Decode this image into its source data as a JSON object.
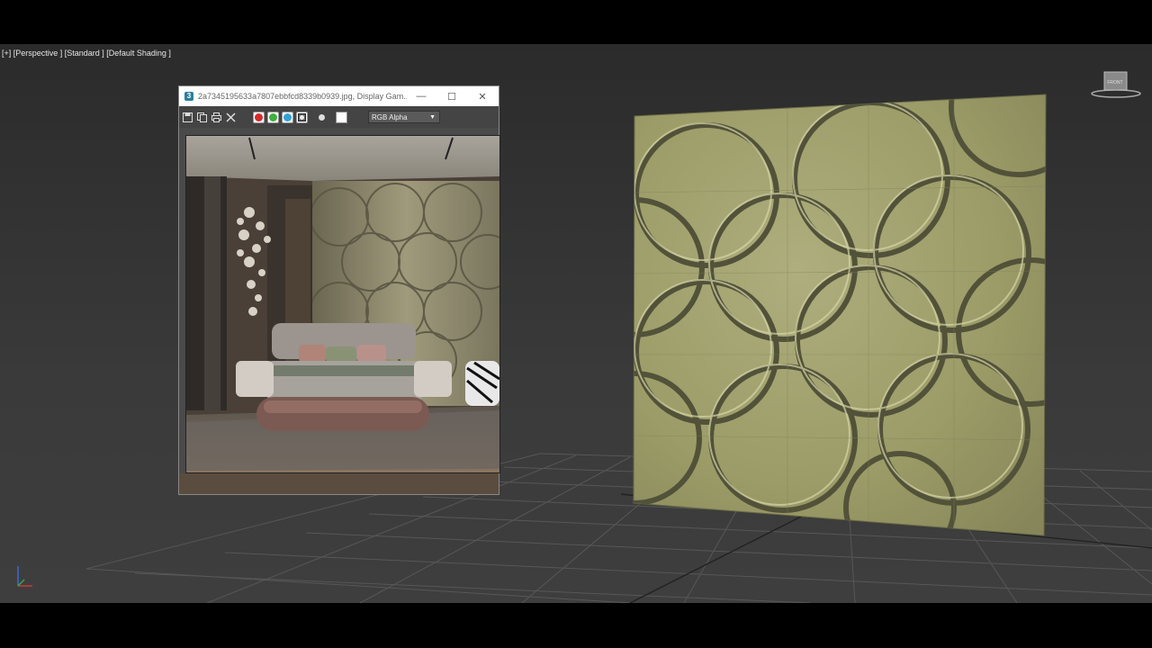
{
  "viewport": {
    "label": "[+] [Perspective ] [Standard ] [Default Shading ]",
    "viewcube_label": "FRONT"
  },
  "viewer": {
    "title": "2a7345195633a7807ebbfcd8339b0939.jpg, Display Gam...",
    "app_icon": "3",
    "minimize": "—",
    "maximize": "☐",
    "close": "✕",
    "channel_select": "RGB Alpha",
    "channels": [
      {
        "name": "red",
        "color": "#d42a2a"
      },
      {
        "name": "green",
        "color": "#3fae3f"
      },
      {
        "name": "blue",
        "color": "#2fa3d8"
      }
    ]
  },
  "colors": {
    "wall_base": "#9e9e6a",
    "wall_groove": "#4d4d33",
    "viewport_bg": "#353535",
    "grid_line": "#5a5a5a"
  }
}
